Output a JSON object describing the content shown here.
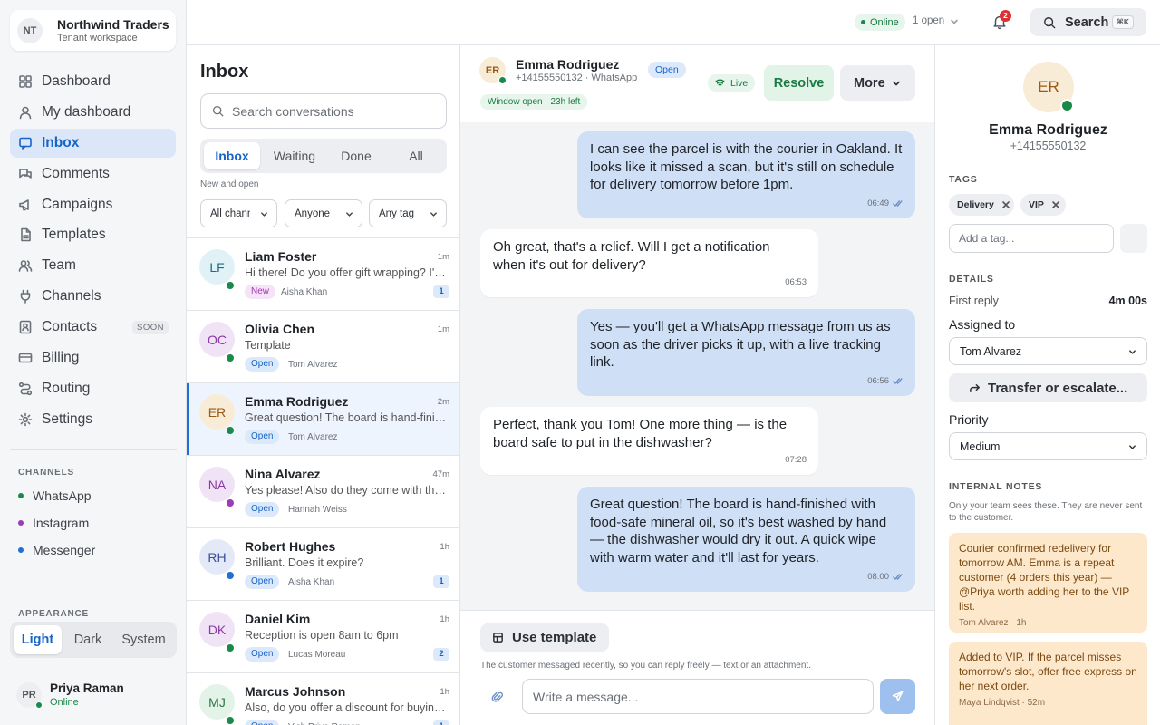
{
  "workspace": {
    "initials": "NT",
    "name": "Northwind Traders",
    "subtitle": "Tenant workspace"
  },
  "nav": [
    {
      "label": "Dashboard",
      "icon": "grid-icon",
      "active": false
    },
    {
      "label": "My dashboard",
      "icon": "user-icon",
      "active": false
    },
    {
      "label": "Inbox",
      "icon": "message-icon",
      "active": true
    },
    {
      "label": "Comments",
      "icon": "comments-icon",
      "active": false
    },
    {
      "label": "Campaigns",
      "icon": "megaphone-icon",
      "active": false
    },
    {
      "label": "Templates",
      "icon": "document-icon",
      "active": false
    },
    {
      "label": "Team",
      "icon": "team-icon",
      "active": false
    },
    {
      "label": "Channels",
      "icon": "plug-icon",
      "active": false
    },
    {
      "label": "Contacts",
      "icon": "contacts-icon",
      "active": false,
      "badge": "SOON"
    },
    {
      "label": "Billing",
      "icon": "card-icon",
      "active": false
    },
    {
      "label": "Routing",
      "icon": "routing-icon",
      "active": false
    },
    {
      "label": "Settings",
      "icon": "gear-icon",
      "active": false
    }
  ],
  "channels": {
    "title": "CHANNELS",
    "items": [
      {
        "label": "WhatsApp",
        "color": "#1a8a4b"
      },
      {
        "label": "Instagram",
        "color": "#9b3bb8"
      },
      {
        "label": "Messenger",
        "color": "#1f6fd6"
      }
    ]
  },
  "appearance": {
    "title": "APPEARANCE",
    "options": [
      "Light",
      "Dark",
      "System"
    ],
    "selected": "Light"
  },
  "user": {
    "initials": "PR",
    "name": "Priya Raman",
    "status": "Online"
  },
  "topbar": {
    "online_label": "Online",
    "open_count": "1 open",
    "notifications": "2",
    "search_label": "Search",
    "shortcut": "⌘K"
  },
  "inbox": {
    "title": "Inbox",
    "search_placeholder": "Search conversations",
    "tabs": [
      "Inbox",
      "Waiting",
      "Done",
      "All"
    ],
    "active_tab": "Inbox",
    "subtitle": "New and open",
    "filters": [
      "All channels",
      "Anyone",
      "Any tag"
    ],
    "conversations": [
      {
        "initials": "LF",
        "name": "Liam Foster",
        "time": "1m",
        "preview": "Hi there! Do you offer gift wrapping? I'd love to send this as a present",
        "status": "New",
        "agent": "Aisha Khan",
        "count": "1",
        "channel_color": "#1a8a4b",
        "avatar_bg": "#e1f2f7",
        "avatar_fg": "#1f6a86"
      },
      {
        "initials": "OC",
        "name": "Olivia Chen",
        "time": "1m",
        "preview": "Template",
        "status": "Open",
        "agent": "Tom Alvarez",
        "count": "",
        "channel_color": "#1a8a4b",
        "avatar_bg": "#f1e3f6",
        "avatar_fg": "#8a3aa5"
      },
      {
        "initials": "ER",
        "name": "Emma Rodriguez",
        "time": "2m",
        "preview": "Great question! The board is hand-finished with food-safe mineral oil",
        "status": "Open",
        "agent": "Tom Alvarez",
        "count": "",
        "channel_color": "#1a8a4b",
        "avatar_bg": "#f8ecd7",
        "avatar_fg": "#9a5a14",
        "active": true
      },
      {
        "initials": "NA",
        "name": "Nina Alvarez",
        "time": "47m",
        "preview": "Yes please! Also do they come with the stand?",
        "status": "Open",
        "agent": "Hannah Weiss",
        "count": "",
        "channel_color": "#9b3bb8",
        "avatar_bg": "#f1e3f6",
        "avatar_fg": "#8a3aa5"
      },
      {
        "initials": "RH",
        "name": "Robert Hughes",
        "time": "1h",
        "preview": "Brilliant. Does it expire?",
        "status": "Open",
        "agent": "Aisha Khan",
        "count": "1",
        "channel_color": "#1f6fd6",
        "avatar_bg": "#e4e9f7",
        "avatar_fg": "#3a4f95"
      },
      {
        "initials": "DK",
        "name": "Daniel Kim",
        "time": "1h",
        "preview": "Reception is open 8am to 6pm",
        "status": "Open",
        "agent": "Lucas Moreau",
        "count": "2",
        "channel_color": "#1a8a4b",
        "avatar_bg": "#f1e3f6",
        "avatar_fg": "#8a3aa5"
      },
      {
        "initials": "MJ",
        "name": "Marcus Johnson",
        "time": "1h",
        "preview": "Also, do you offer a discount for buying in bulk?",
        "status": "Open",
        "agent": "Vish Priya Raman",
        "count": "1",
        "channel_color": "#1a8a4b",
        "avatar_bg": "#e3f3e7",
        "avatar_fg": "#2a7a45"
      }
    ]
  },
  "chat": {
    "contact": {
      "initials": "ER",
      "name": "Emma Rodriguez",
      "subtitle": "+14155550132 · WhatsApp",
      "status": "Open",
      "window": "Window open · 23h left"
    },
    "live_label": "Live",
    "resolve_label": "Resolve",
    "more_label": "More",
    "messages": [
      {
        "dir": "out",
        "text": "I can see the parcel is with the courier in Oakland. It looks like it missed a scan, but it's still on schedule for delivery tomorrow before 1pm.",
        "time": "06:49"
      },
      {
        "dir": "in",
        "text": "Oh great, that's a relief. Will I get a notification when it's out for delivery?",
        "time": "06:53"
      },
      {
        "dir": "out",
        "text": "Yes — you'll get a WhatsApp message from us as soon as the driver picks it up, with a live tracking link.",
        "time": "06:56"
      },
      {
        "dir": "in",
        "text": "Perfect, thank you Tom! One more thing — is the board safe to put in the dishwasher?",
        "time": "07:28"
      },
      {
        "dir": "out",
        "text": "Great question! The board is hand-finished with food-safe mineral oil, so it's best washed by hand — the dishwasher would dry it out. A quick wipe with warm water and it'll last for years.",
        "time": "08:00"
      }
    ],
    "composer": {
      "template_label": "Use template",
      "note": "The customer messaged recently, so you can reply freely — text or an attachment.",
      "placeholder": "Write a message..."
    }
  },
  "details": {
    "initials": "ER",
    "name": "Emma Rodriguez",
    "phone": "+14155550132",
    "tags_title": "TAGS",
    "tags": [
      "Delivery",
      "VIP"
    ],
    "tag_placeholder": "Add a tag...",
    "tag_add": "·",
    "details_title": "DETAILS",
    "first_reply_label": "First reply",
    "first_reply_value": "4m 00s",
    "assigned_label": "Assigned to",
    "assigned_value": "Tom Alvarez",
    "transfer_label": "Transfer or escalate...",
    "priority_label": "Priority",
    "priority_value": "Medium",
    "notes_title": "INTERNAL NOTES",
    "notes_sub": "Only your team sees these. They are never sent to the customer.",
    "notes": [
      {
        "text": "Courier confirmed redelivery for tomorrow AM. Emma is a repeat customer (4 orders this year) — @Priya worth adding her to the VIP list.",
        "meta": "Tom Alvarez · 1h"
      },
      {
        "text": "Added to VIP. If the parcel misses tomorrow's slot, offer free express on her next order.",
        "meta": "Maya Lindqvist · 52m"
      }
    ]
  }
}
